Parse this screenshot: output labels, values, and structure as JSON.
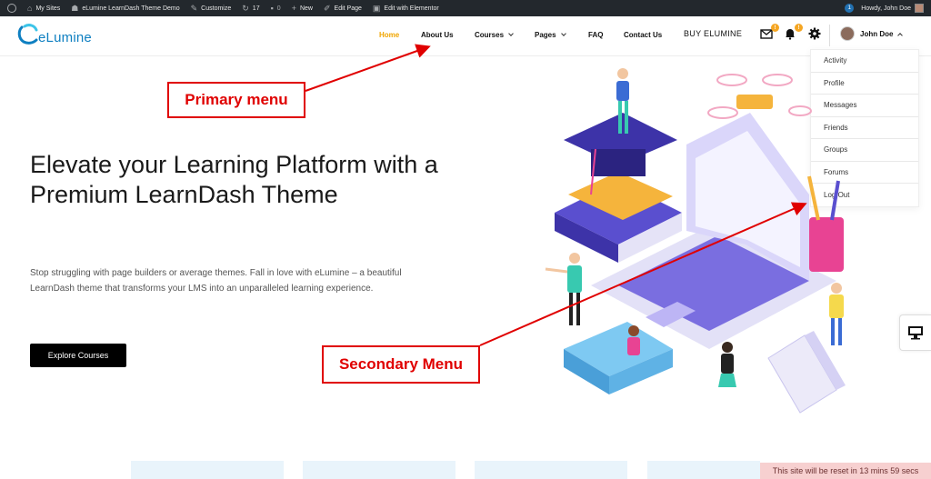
{
  "adminbar": {
    "my_sites": "My Sites",
    "site_name": "eLumine LearnDash Theme Demo",
    "customize": "Customize",
    "updates_count": "17",
    "comments_count": "0",
    "new": "New",
    "edit_page": "Edit Page",
    "edit_elementor": "Edit with Elementor",
    "notif_count": "1",
    "howdy": "Howdy, John Doe"
  },
  "header": {
    "logo_text": "eLumine",
    "nav": {
      "home": "Home",
      "about": "About Us",
      "courses": "Courses",
      "pages": "Pages",
      "faq": "FAQ",
      "contact": "Contact Us",
      "buy": "BUY ELUMINE"
    },
    "messages_badge": "!",
    "notifications_badge": "!",
    "user_name": "John Doe",
    "accent_color": "#f0a500",
    "brand_color": "#0e7fc1"
  },
  "user_menu": {
    "items": [
      {
        "label": "Activity"
      },
      {
        "label": "Profile"
      },
      {
        "label": "Messages"
      },
      {
        "label": "Friends"
      },
      {
        "label": "Groups"
      },
      {
        "label": "Forums"
      },
      {
        "label": "Log Out"
      }
    ]
  },
  "hero": {
    "title": "Elevate your Learning Platform with a Premium LearnDash Theme",
    "subtitle": "Stop struggling with page builders or average themes. Fall in love with eLumine – a beautiful LearnDash theme that transforms your LMS into an unparalleled learning experience.",
    "cta": "Explore Courses"
  },
  "annotations": {
    "primary_menu": "Primary menu",
    "secondary_menu": "Secondary Menu",
    "color": "#e00000"
  },
  "footer": {
    "reset_notice": "This site will be reset in 13 mins 59 secs"
  }
}
